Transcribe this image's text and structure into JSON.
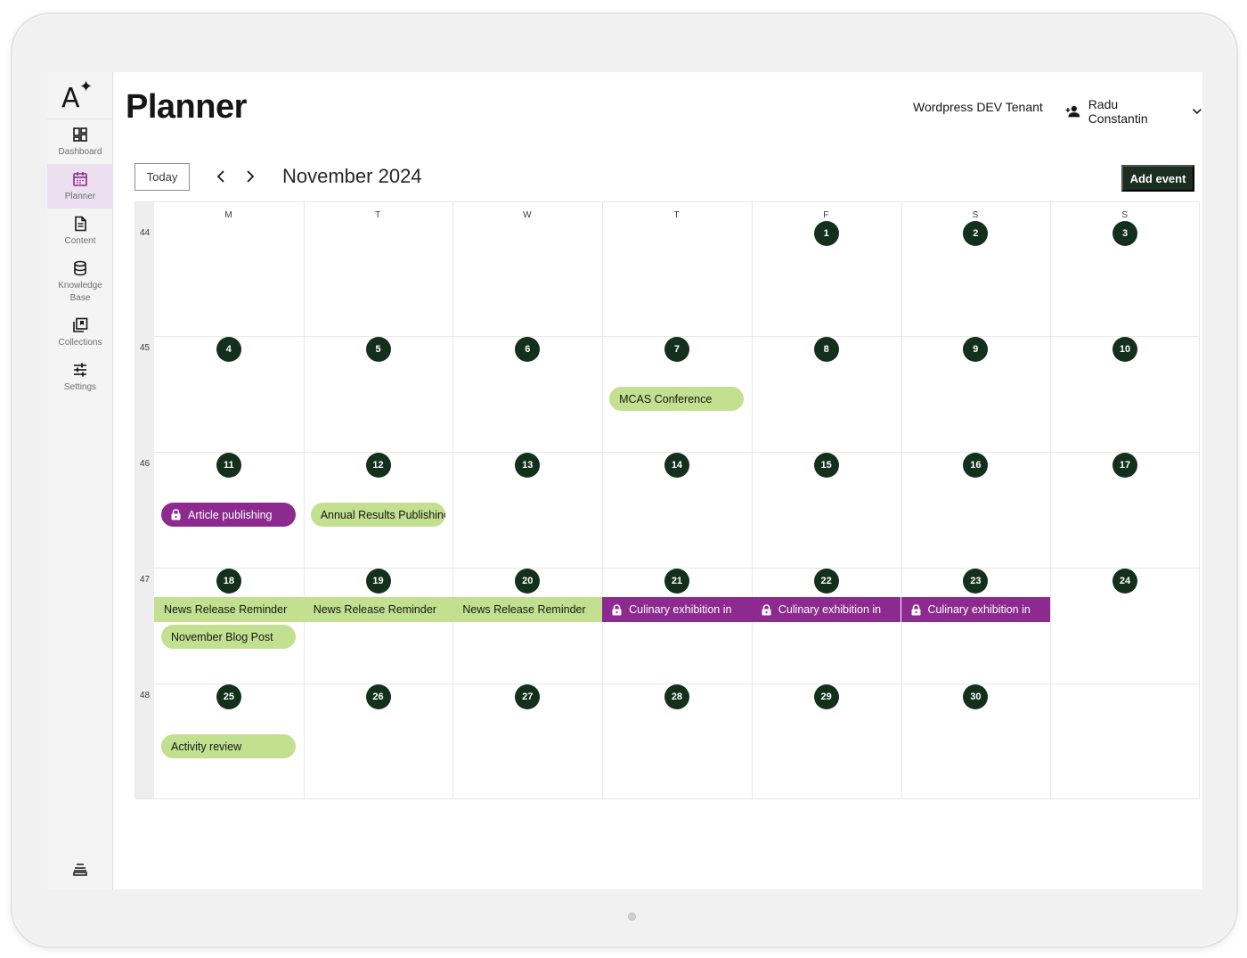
{
  "sidebar": {
    "logo": {
      "letter": "A",
      "star": "✦"
    },
    "items": [
      {
        "label": "Dashboard",
        "icon": "dashboard-icon"
      },
      {
        "label": "Planner",
        "icon": "calendar-icon",
        "active": true
      },
      {
        "label": "Content",
        "icon": "document-icon"
      },
      {
        "label": "Knowledge Base",
        "icon": "database-icon"
      },
      {
        "label": "Collections",
        "icon": "collections-icon"
      },
      {
        "label": "Settings",
        "icon": "sliders-icon"
      }
    ],
    "bottom": {
      "label": "Notebook",
      "icon": "notebook-icon"
    }
  },
  "header": {
    "title": "Planner",
    "tenant": "Wordpress DEV Tenant",
    "user_name": "Radu Constantin"
  },
  "toolbar": {
    "today_label": "Today",
    "month_title": "November 2024",
    "add_event_label": "Add event"
  },
  "calendar": {
    "weekdays": [
      "M",
      "T",
      "W",
      "T",
      "F",
      "S",
      "S"
    ],
    "weeks": [
      {
        "number": "44",
        "days": [
          "",
          "",
          "",
          "",
          "1",
          "2",
          "3"
        ]
      },
      {
        "number": "45",
        "days": [
          "4",
          "5",
          "6",
          "7",
          "8",
          "9",
          "10"
        ]
      },
      {
        "number": "46",
        "days": [
          "11",
          "12",
          "13",
          "14",
          "15",
          "16",
          "17"
        ]
      },
      {
        "number": "47",
        "days": [
          "18",
          "19",
          "20",
          "21",
          "22",
          "23",
          "24"
        ]
      },
      {
        "number": "48",
        "days": [
          "25",
          "26",
          "27",
          "28",
          "29",
          "30",
          ""
        ]
      }
    ],
    "events": [
      {
        "title": "MCAS Conference",
        "day": "7",
        "style": "green",
        "locked": false
      },
      {
        "title": "Article publishing",
        "day": "11",
        "style": "purple",
        "locked": true
      },
      {
        "title": "Annual Results Publishing",
        "day": "12",
        "style": "green",
        "locked": false
      },
      {
        "title": "News Release Reminder",
        "day": "18",
        "style": "green",
        "locked": false
      },
      {
        "title": "News Release Reminder",
        "day": "19",
        "style": "green",
        "locked": false
      },
      {
        "title": "News Release Reminder",
        "day": "20",
        "style": "green",
        "locked": false
      },
      {
        "title": "Culinary exhibition in",
        "day": "21",
        "style": "purple",
        "locked": true
      },
      {
        "title": "Culinary exhibition in",
        "day": "22",
        "style": "purple",
        "locked": true
      },
      {
        "title": "Culinary exhibition in",
        "day": "23",
        "style": "purple",
        "locked": true
      },
      {
        "title": "November Blog Post",
        "day": "18",
        "style": "green",
        "locked": false
      },
      {
        "title": "Activity review",
        "day": "25",
        "style": "green",
        "locked": false
      }
    ]
  },
  "colors": {
    "accent_dark": "#13301c",
    "event_green": "#c2e08f",
    "event_purple": "#8c2a8f",
    "active_nav": "#ecdff0"
  }
}
